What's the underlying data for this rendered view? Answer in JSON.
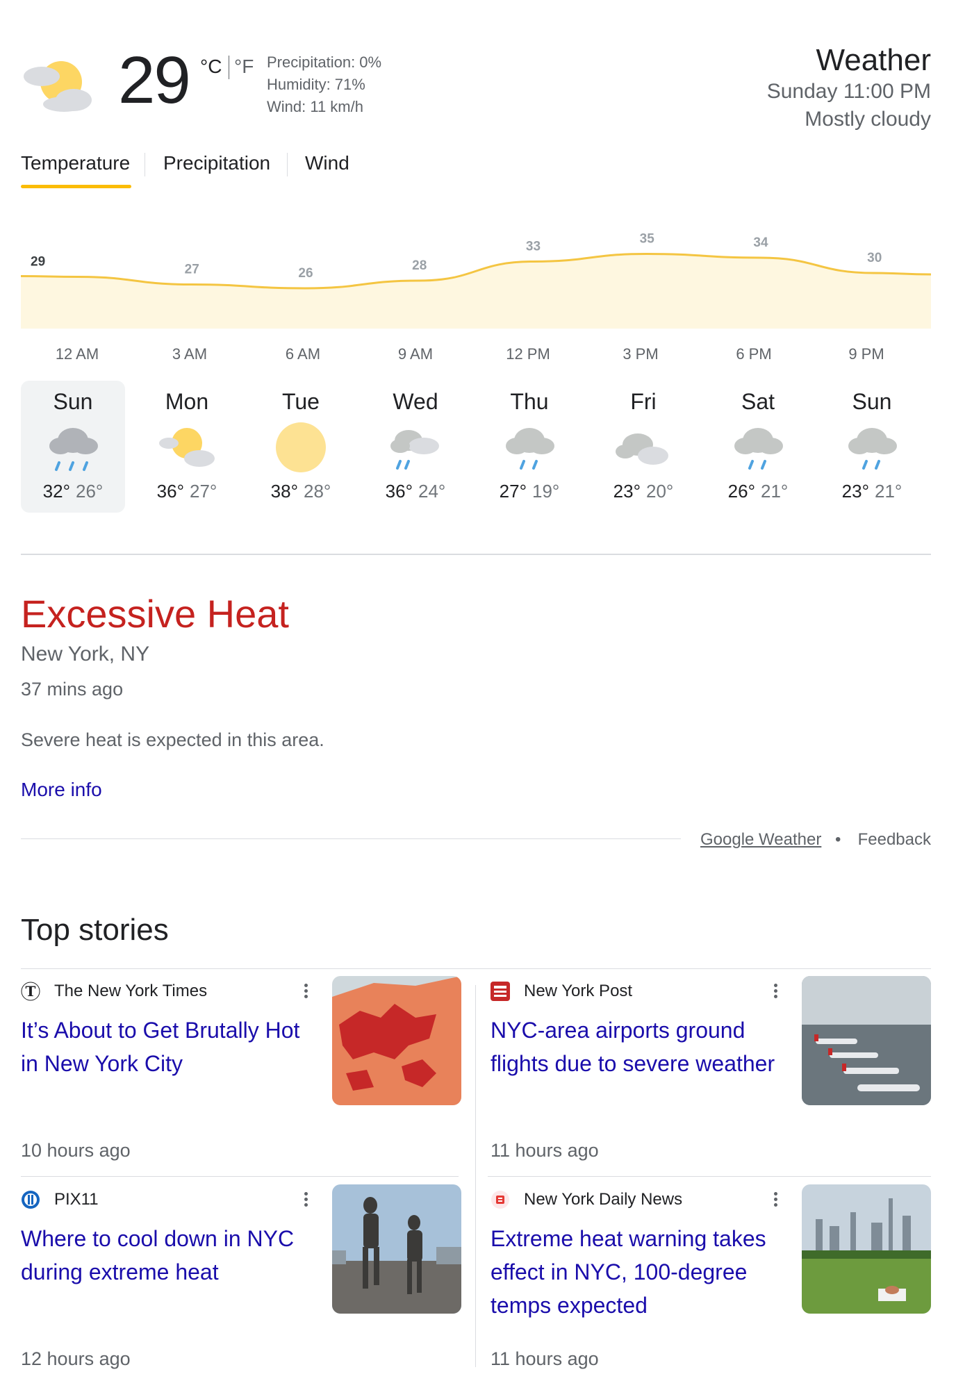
{
  "weather": {
    "current_temp": "29",
    "unit_c": "°C",
    "unit_f": "°F",
    "precipitation": "Precipitation: 0%",
    "humidity": "Humidity: 71%",
    "wind": "Wind: 11 km/h",
    "title": "Weather",
    "datetime": "Sunday 11:00 PM",
    "condition": "Mostly cloudy",
    "current_icon": "partly-cloudy-night-icon",
    "tabs": [
      {
        "label": "Temperature",
        "active": true
      },
      {
        "label": "Precipitation",
        "active": false
      },
      {
        "label": "Wind",
        "active": false
      }
    ],
    "hours": [
      "12 AM",
      "3 AM",
      "6 AM",
      "9 AM",
      "12 PM",
      "3 PM",
      "6 PM",
      "9 PM"
    ],
    "days": [
      {
        "name": "Sun",
        "hi": "32°",
        "lo": "26°",
        "icon": "rain-icon",
        "selected": true
      },
      {
        "name": "Mon",
        "hi": "36°",
        "lo": "27°",
        "icon": "partly-cloudy-icon",
        "selected": false
      },
      {
        "name": "Tue",
        "hi": "38°",
        "lo": "28°",
        "icon": "sunny-icon",
        "selected": false
      },
      {
        "name": "Wed",
        "hi": "36°",
        "lo": "24°",
        "icon": "showers-icon",
        "selected": false
      },
      {
        "name": "Thu",
        "hi": "27°",
        "lo": "19°",
        "icon": "light-rain-icon",
        "selected": false
      },
      {
        "name": "Fri",
        "hi": "23°",
        "lo": "20°",
        "icon": "cloudy-icon",
        "selected": false
      },
      {
        "name": "Sat",
        "hi": "26°",
        "lo": "21°",
        "icon": "light-rain-icon",
        "selected": false
      },
      {
        "name": "Sun",
        "hi": "23°",
        "lo": "21°",
        "icon": "light-rain-icon",
        "selected": false
      }
    ],
    "colors": {
      "accent": "#fbbc04",
      "fill": "#fef7e0",
      "line": "#f4c542",
      "alert": "#c5221f",
      "link": "#1a0dab"
    }
  },
  "chart_data": {
    "type": "area",
    "x": [
      "12 AM",
      "3 AM",
      "6 AM",
      "9 AM",
      "12 PM",
      "3 PM",
      "6 PM",
      "9 PM"
    ],
    "values": [
      29,
      27,
      26,
      28,
      33,
      35,
      34,
      30
    ],
    "data_labels": [
      "29",
      "27",
      "26",
      "28",
      "33",
      "35",
      "34",
      "30"
    ],
    "grid": false
  },
  "alert": {
    "title": "Excessive Heat",
    "location": "New York, NY",
    "ago": "37 mins ago",
    "description": "Severe heat is expected in this area.",
    "more": "More info"
  },
  "footer": {
    "google_weather": "Google Weather",
    "dot": "•",
    "feedback": "Feedback"
  },
  "top_stories": {
    "title": "Top stories",
    "stories": [
      {
        "source": "The New York Times",
        "source_icon": "nyt-logo-icon",
        "headline": "It’s About to Get Brutally Hot in New York City",
        "ago": "10 hours ago",
        "thumb": "heat-map-thumbnail"
      },
      {
        "source": "New York Post",
        "source_icon": "ny-post-logo-icon",
        "headline": "NYC-area airports ground flights due to severe weather",
        "ago": "11 hours ago",
        "thumb": "airport-planes-thumbnail"
      },
      {
        "source": "PIX11",
        "source_icon": "pix11-logo-icon",
        "headline": "Where to cool down in NYC during extreme heat",
        "ago": "12 hours ago",
        "thumb": "people-walking-thumbnail"
      },
      {
        "source": "New York Daily News",
        "source_icon": "ny-daily-news-logo-icon",
        "headline": "Extreme heat warning takes effect in NYC, 100-degree temps expected",
        "ago": "11 hours ago",
        "thumb": "central-park-thumbnail"
      }
    ]
  }
}
